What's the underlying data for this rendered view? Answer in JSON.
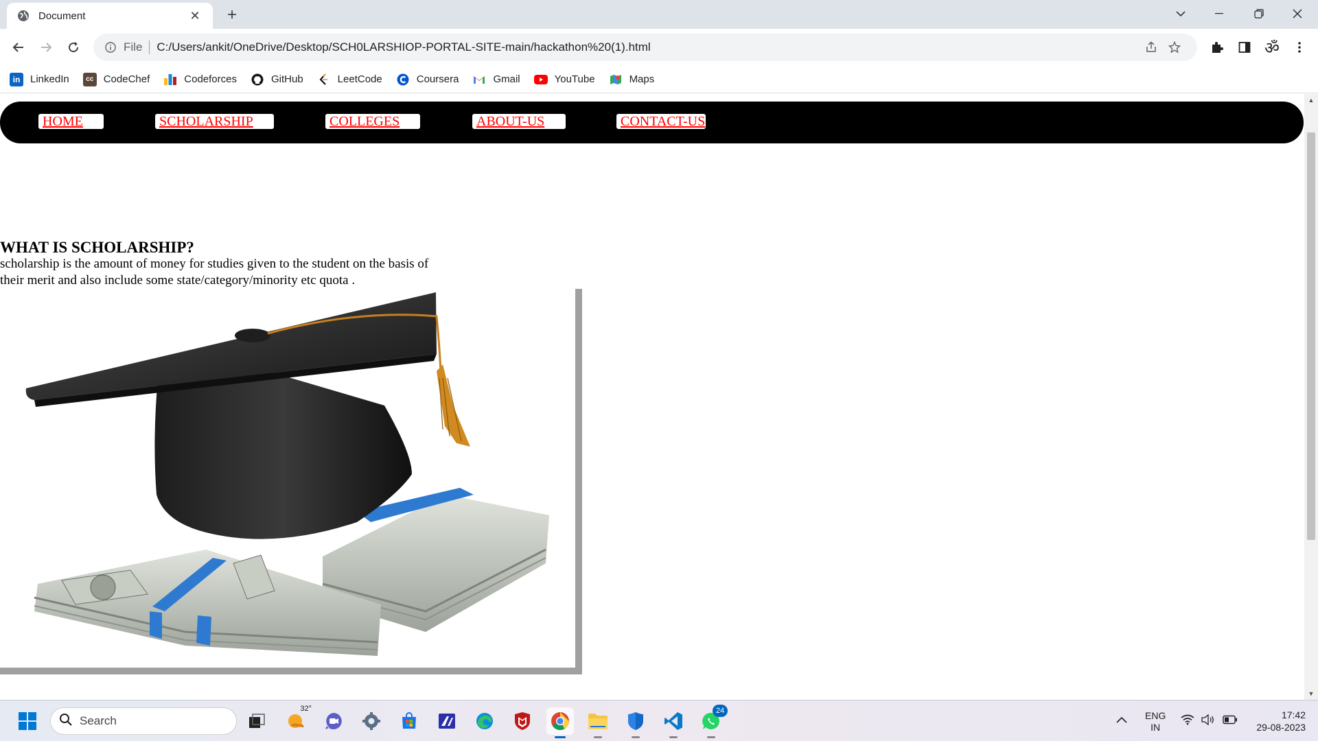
{
  "browser": {
    "tab_title": "Document",
    "url_scheme": "File",
    "url": "C:/Users/ankit/OneDrive/Desktop/SCH0LARSHIOP-PORTAL-SITE-main/hackathon%20(1).html",
    "bookmarks": [
      {
        "label": "LinkedIn",
        "icon": "linkedin-icon",
        "color": "#0a66c2"
      },
      {
        "label": "CodeChef",
        "icon": "codechef-icon",
        "color": "#5b4638"
      },
      {
        "label": "Codeforces",
        "icon": "codeforces-icon",
        "color": "#1f8acb"
      },
      {
        "label": "GitHub",
        "icon": "github-icon",
        "color": "#181717"
      },
      {
        "label": "LeetCode",
        "icon": "leetcode-icon",
        "color": "#ffa116"
      },
      {
        "label": "Coursera",
        "icon": "coursera-icon",
        "color": "#0056d2"
      },
      {
        "label": "Gmail",
        "icon": "gmail-icon",
        "color": "#ea4335"
      },
      {
        "label": "YouTube",
        "icon": "youtube-icon",
        "color": "#ff0000"
      },
      {
        "label": "Maps",
        "icon": "maps-icon",
        "color": "#34a853"
      }
    ]
  },
  "page": {
    "nav": [
      {
        "label": "HOME"
      },
      {
        "label": "SCHOLARSHIP"
      },
      {
        "label": "COLLEGES"
      },
      {
        "label": "ABOUT-US"
      },
      {
        "label": "CONTACT-US"
      }
    ],
    "heading": "WHAT IS SCHOLARSHIP?",
    "paragraph": "scholarship is the amount of money for studies given to the student on the basis of their merit and also include some state/category/minority etc quota .",
    "link_color": "#ff0000",
    "navbar_color": "#000000"
  },
  "taskbar": {
    "search_label": "Search",
    "weather_temp": "32°",
    "whatsapp_badge": "24",
    "lang_line1": "ENG",
    "lang_line2": "IN",
    "time": "17:42",
    "date": "29-08-2023"
  }
}
